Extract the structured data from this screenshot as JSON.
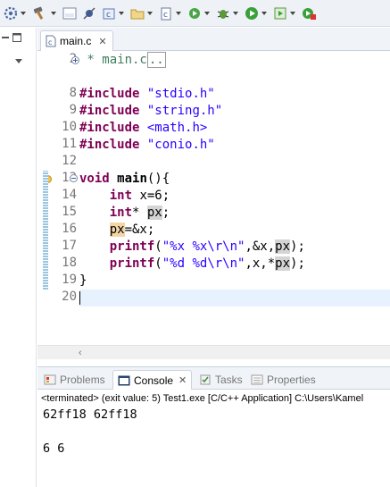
{
  "toolbar": {
    "icons": [
      "settings-gear-icon",
      "hammer-build-icon",
      "binary-010-icon",
      "skip-breakpoints-icon",
      "new-c-project-icon",
      "new-folder-icon",
      "new-c-file-icon",
      "refresh-run-icon",
      "debug-bug-icon",
      "run-play-icon",
      "run-coverage-icon",
      "external-tools-icon"
    ]
  },
  "editor": {
    "tab_label": "main.c",
    "line_numbers": [
      "2",
      "",
      "8",
      "9",
      "10",
      "11",
      "12",
      "13",
      "14",
      "15",
      "16",
      "17",
      "18",
      "19",
      "20"
    ],
    "lines": {
      "l2": " * main.c",
      "l2_fold": "..",
      "l8_kw": "#include",
      "l8_str": " \"stdio.h\"",
      "l9_kw": "#include",
      "l9_str": " \"string.h\"",
      "l10_kw": "#include",
      "l10_str": " <math.h>",
      "l11_kw": "#include",
      "l11_str": " \"conio.h\"",
      "l13_kw": "void",
      "l13_rest_a": " ",
      "l13_fn": "main",
      "l13_rest_b": "(){",
      "l14_ind": "    ",
      "l14_kw": "int",
      "l14_rest": " x=6;",
      "l15_ind": "    ",
      "l15_kw": "int",
      "l15_star": "* ",
      "l15_px": "px",
      "l15_semi": ";",
      "l16_ind": "    ",
      "l16_px": "px",
      "l16_rest": "=&x;",
      "l17_ind": "    ",
      "l17_kw": "printf",
      "l17_open": "(",
      "l17_str": "\"%x %x\\r\\n\"",
      "l17_mid": ",&x,",
      "l17_px": "px",
      "l17_close": ");",
      "l18_ind": "    ",
      "l18_kw": "printf",
      "l18_open": "(",
      "l18_str": "\"%d %d\\r\\n\"",
      "l18_mid": ",x,*",
      "l18_px": "px",
      "l18_close": ");",
      "l19": "}",
      "l20": ""
    }
  },
  "views": {
    "tabs": [
      "Problems",
      "Console",
      "Tasks",
      "Properties"
    ],
    "active_tab": "Console"
  },
  "console": {
    "status": "<terminated> (exit value: 5) Test1.exe [C/C++ Application] C:\\Users\\Kamel",
    "output": [
      "62ff18 62ff18",
      "",
      "6 6"
    ]
  }
}
